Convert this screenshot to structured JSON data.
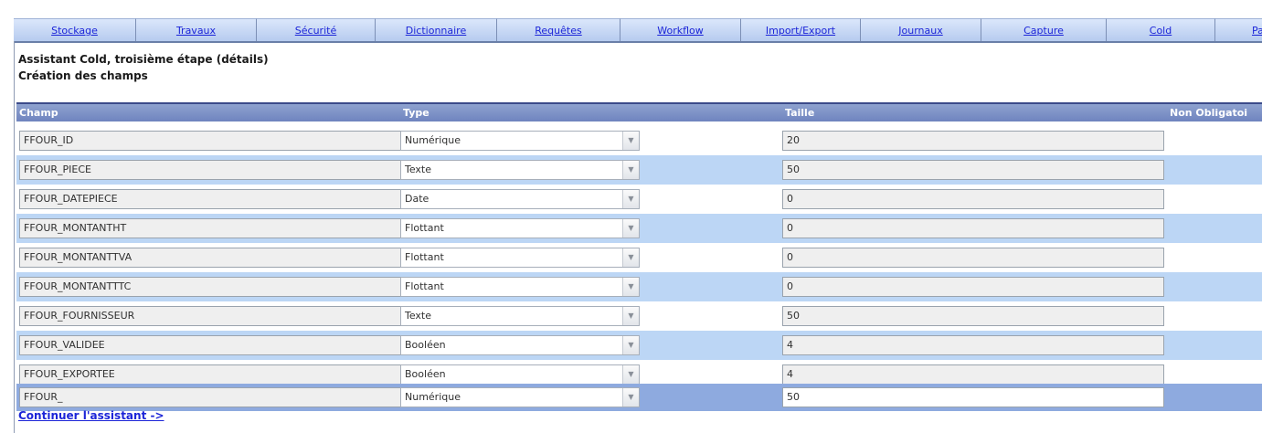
{
  "tabs": [
    "Stockage",
    "Travaux",
    "Sécurité",
    "Dictionnaire",
    "Requêtes",
    "Workflow",
    "Import/Export",
    "Journaux",
    "Capture",
    "Cold",
    "Pa"
  ],
  "heading": {
    "title": "Assistant Cold, troisième étape (détails)",
    "subtitle": "Création des champs"
  },
  "table": {
    "headers": {
      "champ": "Champ",
      "type": "Type",
      "taille": "Taille",
      "non_obligatoire": "Non Obligatoi"
    },
    "rows": [
      {
        "champ": "FFOUR_ID",
        "type": "Numérique",
        "taille": "20"
      },
      {
        "champ": "FFOUR_PIECE",
        "type": "Texte",
        "taille": "50"
      },
      {
        "champ": "FFOUR_DATEPIECE",
        "type": "Date",
        "taille": "0"
      },
      {
        "champ": "FFOUR_MONTANTHT",
        "type": "Flottant",
        "taille": "0"
      },
      {
        "champ": "FFOUR_MONTANTTVA",
        "type": "Flottant",
        "taille": "0"
      },
      {
        "champ": "FFOUR_MONTANTTTC",
        "type": "Flottant",
        "taille": "0"
      },
      {
        "champ": "FFOUR_FOURNISSEUR",
        "type": "Texte",
        "taille": "50"
      },
      {
        "champ": "FFOUR_VALIDEE",
        "type": "Booléen",
        "taille": "4"
      },
      {
        "champ": "FFOUR_EXPORTEE",
        "type": "Booléen",
        "taille": "4"
      },
      {
        "champ": "FFOUR_",
        "type": "Numérique",
        "taille": "50"
      }
    ]
  },
  "continue_link": "Continuer l'assistant ->",
  "colors": {
    "tab_link": "#1c25d8",
    "row_alt": "#bcd6f5",
    "row_selected": "#8eaadf",
    "header": "#7f94c8"
  },
  "icons": {
    "dropdown": "chevron-down-icon"
  }
}
